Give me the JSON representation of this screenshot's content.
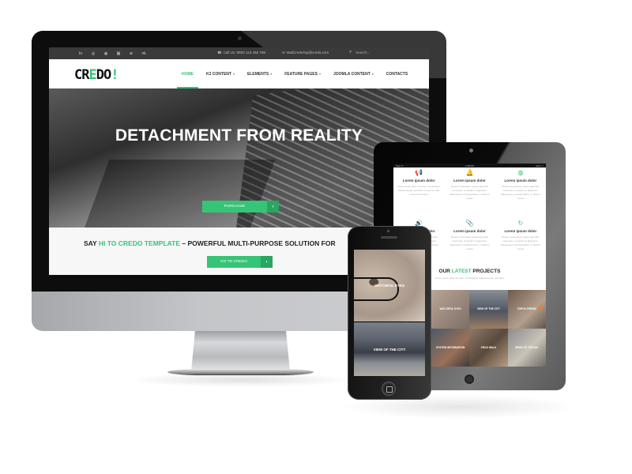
{
  "desktop": {
    "topbar": {
      "social_icons": [
        {
          "name": "linkedin-icon",
          "glyph": "in"
        },
        {
          "name": "dribbble-icon",
          "glyph": "◎"
        },
        {
          "name": "pinterest-icon",
          "glyph": "◉"
        },
        {
          "name": "vimeo-icon",
          "glyph": "▣"
        },
        {
          "name": "instagram-icon",
          "glyph": "◙"
        },
        {
          "name": "vk-icon",
          "glyph": "vk"
        }
      ],
      "phone_icon": "☎",
      "call_text": "Call Us: 0800 123 456 789",
      "mail_icon": "✉",
      "mail_text": "MailCredoTop@credo.com",
      "search_icon": "⚲",
      "search_placeholder": "Search..."
    },
    "header": {
      "logo_parts": [
        "CR",
        "E",
        "DO",
        "!"
      ],
      "nav": [
        {
          "label": "HOME",
          "caret": "",
          "active": true
        },
        {
          "label": "K2 CONTENT",
          "caret": "▾",
          "active": false
        },
        {
          "label": "ELEMENTS",
          "caret": "▾",
          "active": false
        },
        {
          "label": "FEATURE PAGES",
          "caret": "▾",
          "active": false
        },
        {
          "label": "JOOMLA CONTENT",
          "caret": "▾",
          "active": false
        },
        {
          "label": "CONTACTS",
          "caret": "",
          "active": false
        }
      ]
    },
    "hero": {
      "title": "DETACHMENT FROM REALITY",
      "button_label": "PURCHASE",
      "button_arrow": "›"
    },
    "sayhi": {
      "prefix": "SAY ",
      "highlight": "HI TO CREDO TEMPLATE",
      "suffix": " – POWERFUL MULTI-PURPOSE SOLUTION FOR",
      "button_label": "GO TO CREDO",
      "button_arrow": "›"
    }
  },
  "tablet": {
    "status": {
      "left": "iPad ᯤ",
      "center": "1:58 PM",
      "right": "92% ▭"
    },
    "features": [
      {
        "icon_name": "megaphone-icon",
        "glyph": "📢",
        "title": "Lorem ipsum dolor",
        "text": "Lorem ipsum dolor sit amet, consectetuer adipiscing elit, sed diam nonummy nibh euismod tincidunt"
      },
      {
        "icon_name": "bell-icon",
        "glyph": "🔔",
        "title": "Lorem ipsum dolor",
        "text": "Donec consectetur metus eget felis commodo, ut iaculis mi dignissim. Maecenas ut suscipit libero, in dictum metus"
      },
      {
        "icon_name": "globe-icon",
        "glyph": "◍",
        "title": "Lorem ipsum dolor",
        "text": "Donec consectetur metus eget felis commodo, ut iaculis mi dignissim. Maecenas in suscipit libero, in dictum metus"
      },
      {
        "icon_name": "volume-icon",
        "glyph": "🔊",
        "title": "Lorem ipsum dolor",
        "text": "Donec consectetur metus eget felis commodo, ut iaculis mi dignissim. Maecenas in suscipit libero, in dictum metus"
      },
      {
        "icon_name": "paperclip-icon",
        "glyph": "📎",
        "title": "Lorem ipsum dolor",
        "text": "Donec consectetur metus eget felis commodo, ut iaculis mi dignissim. Maecenas in suscipit libero, in dictum metus"
      },
      {
        "icon_name": "refresh-icon",
        "glyph": "↻",
        "title": "Lorem ipsum dolor",
        "text": "Donec consectetur metus eget felis commodo, ut iaculis mi dignissim. Maecenas in suscipit libero, in dictum metus"
      }
    ],
    "projects": {
      "title_prefix": "OUR ",
      "title_highlight": "LATEST",
      "title_suffix": " PROJECTS",
      "subtitle": "Lorem ipsum dolor sit amet, consectetuer adipiscing elit, sed diam",
      "items": [
        "WATCHFUL EYES",
        "VIEW OF THE CITY",
        "CHECK FRIEND",
        "SYSTEM INFORMATION",
        "FIELD WALK",
        "NEWS OF THE DAY"
      ]
    }
  },
  "phone": {
    "cards": [
      "WATCHFUL EYES",
      "VIEW OF THE CITY"
    ]
  },
  "colors": {
    "accent": "#36c476",
    "accent_dark": "#2ba562",
    "topbar_bg": "#3a3a3a"
  }
}
